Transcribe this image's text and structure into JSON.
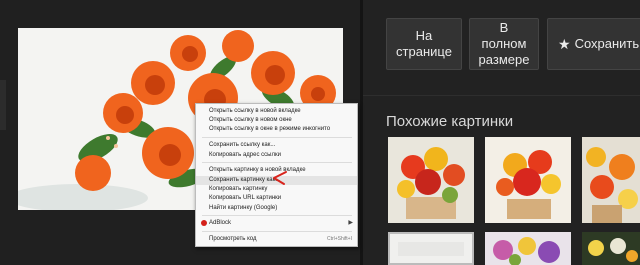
{
  "buttons": {
    "on_page": [
      "На",
      "странице"
    ],
    "full_size": [
      "В",
      "полном",
      "размере"
    ],
    "save": "Сохранить",
    "save_icon": "star-icon"
  },
  "similar": {
    "title": "Похожие картинки"
  },
  "context_menu": {
    "items": [
      "Открыть ссылку в новой вкладке",
      "Открыть ссылку в новом окне",
      "Открыть ссылку в окне в режиме инкогнито",
      "Сохранить ссылку как...",
      "Копировать адрес ссылки",
      "Открыть картинку в новой вкладке",
      "Сохранить картинку как...",
      "Копировать картинку",
      "Копировать URL картинки",
      "Найти картинку (Google)",
      "AdBlock",
      "Просмотреть код"
    ],
    "highlighted_item": "Сохранить картинку как...",
    "shortcut_inspect": "Ctrl+Shift+I",
    "adblock_icon": "adblock-icon",
    "submenu_icon": "chevron-right-icon"
  },
  "colors": {
    "background": "#1f1f1f",
    "button_bg": "#333333",
    "annotation_mark": "#d8241c",
    "rose": "#f0641e"
  }
}
